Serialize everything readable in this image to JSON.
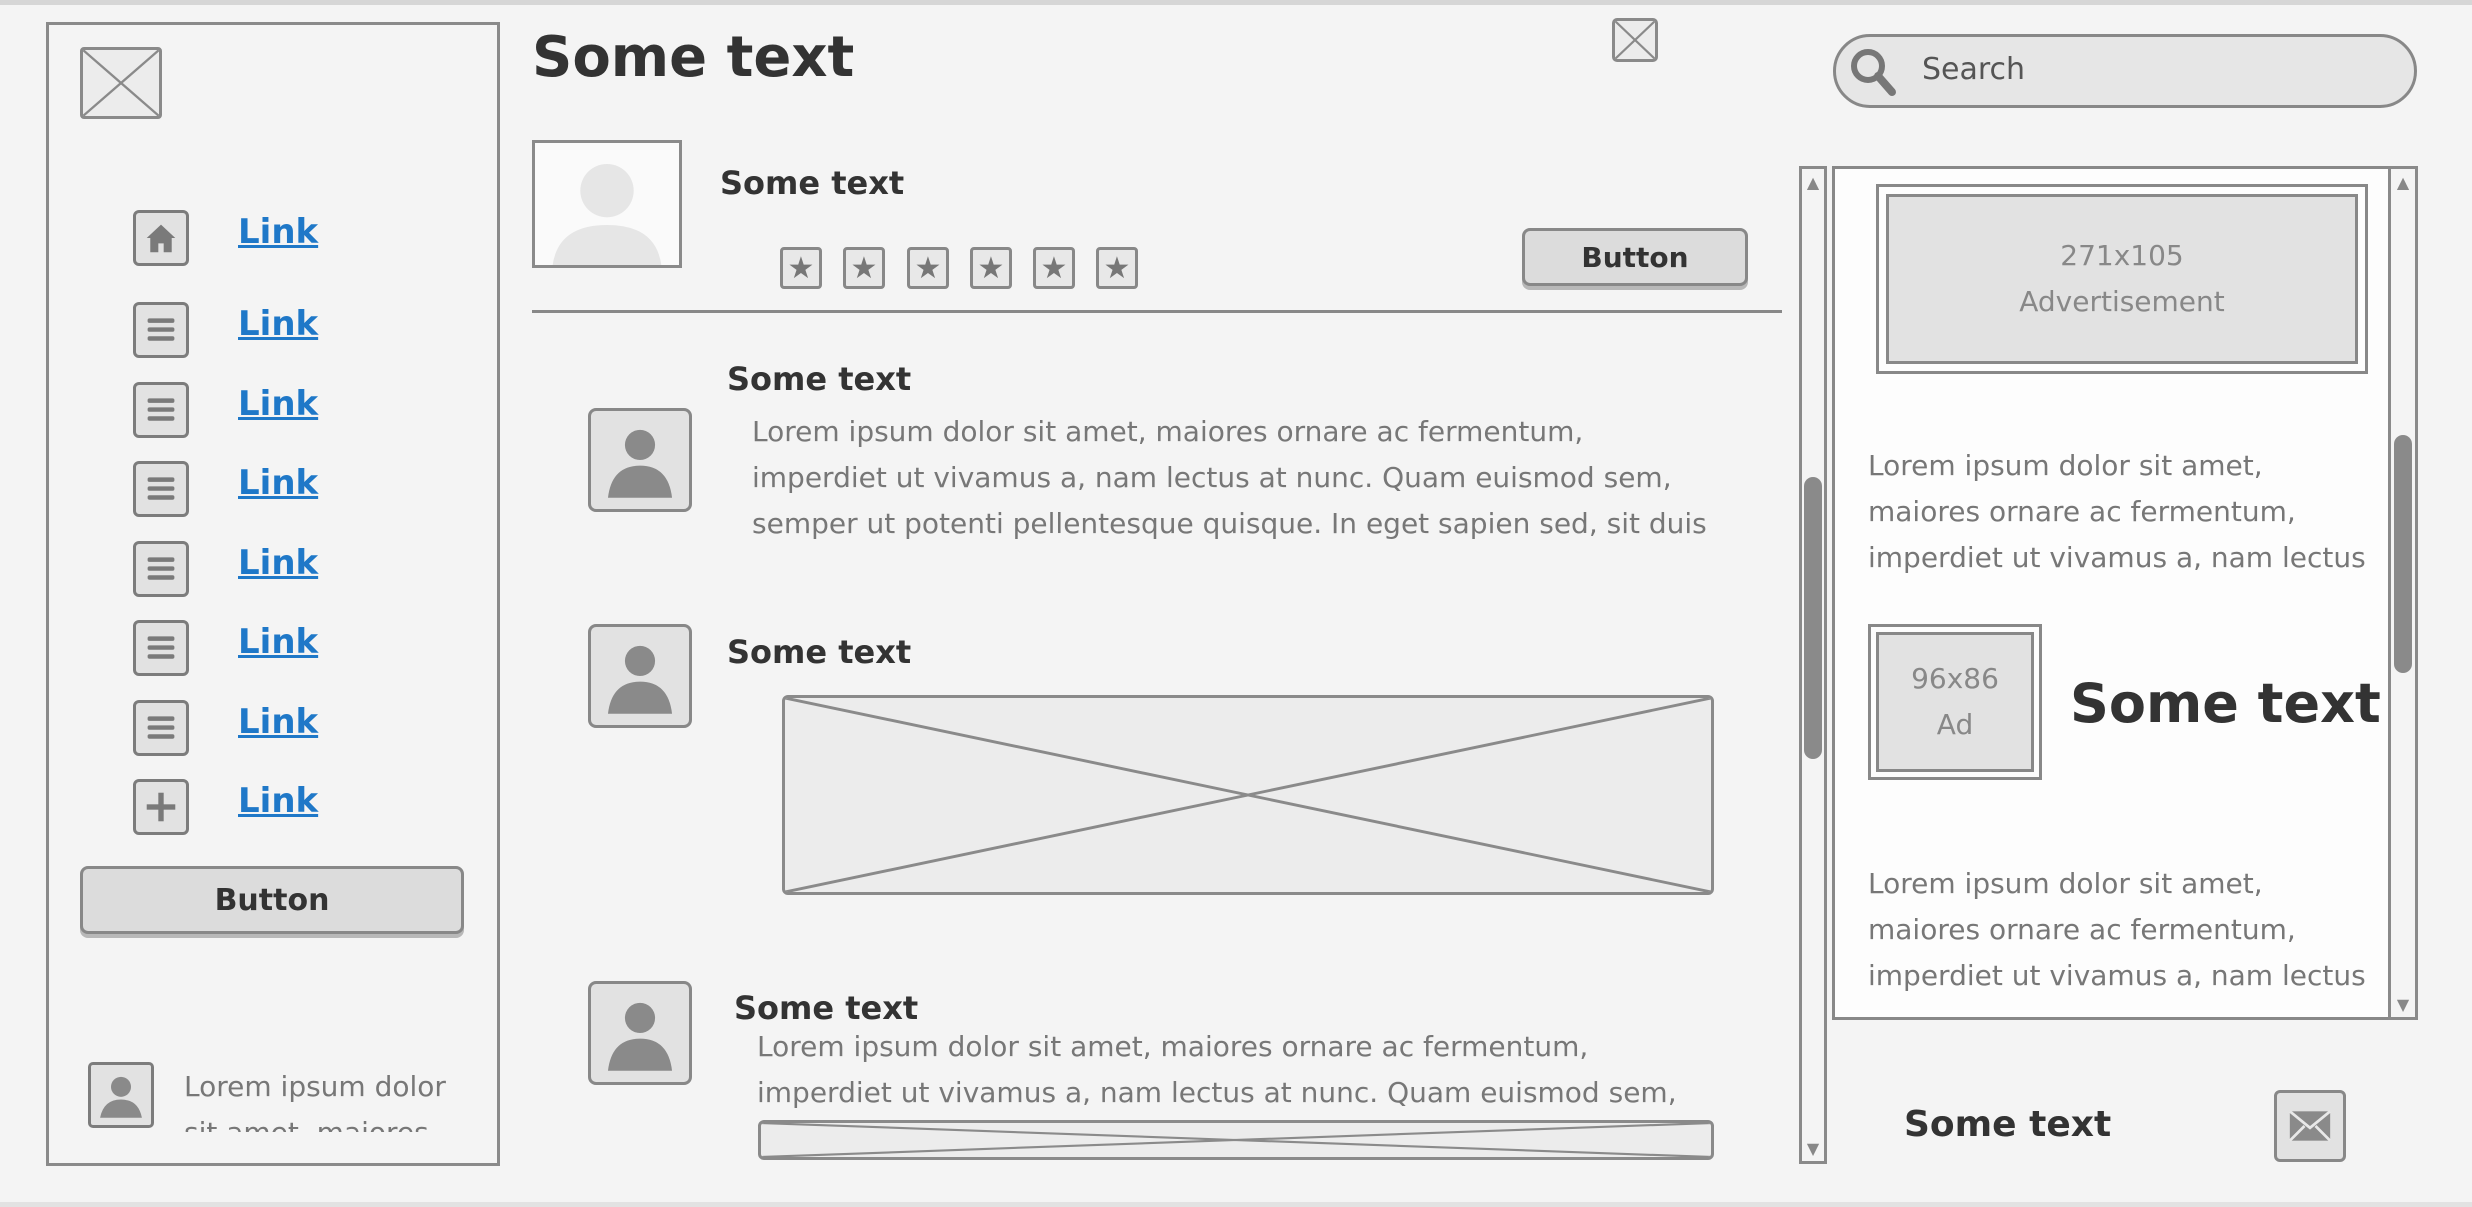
{
  "header": {
    "title": "Some text",
    "search_placeholder": "Search"
  },
  "sidebar": {
    "items": [
      {
        "label": "Link",
        "icon": "home-icon"
      },
      {
        "label": "Link",
        "icon": "list-icon"
      },
      {
        "label": "Link",
        "icon": "list-icon"
      },
      {
        "label": "Link",
        "icon": "list-icon"
      },
      {
        "label": "Link",
        "icon": "list-icon"
      },
      {
        "label": "Link",
        "icon": "list-icon"
      },
      {
        "label": "Link",
        "icon": "list-icon"
      },
      {
        "label": "Link",
        "icon": "plus-icon"
      }
    ],
    "button_label": "Button",
    "footer_text": "Lorem ipsum dolor sit amet, maiores ornare"
  },
  "profile": {
    "name": "Some text",
    "rating_stars": 6,
    "button_label": "Button"
  },
  "feed": [
    {
      "title": "Some text",
      "body": "Lorem ipsum dolor sit amet, maiores ornare ac fermentum, imperdiet ut vivamus a, nam lectus at nunc. Quam euismod sem, semper ut potenti pellentesque quisque. In eget sapien sed, sit duis vestibulum ultricies,"
    },
    {
      "title": "Some text"
    },
    {
      "title": "Some text",
      "body": "Lorem ipsum dolor sit amet, maiores ornare ac fermentum, imperdiet ut vivamus a, nam lectus at nunc. Quam euismod sem, semper ut potenti"
    }
  ],
  "right_panel": {
    "ad_top": {
      "size": "271x105",
      "label": "Advertisement"
    },
    "text1": "Lorem ipsum dolor sit amet, maiores ornare ac fermentum, imperdiet ut vivamus a, nam lectus at nunc. Quam",
    "ad_small": {
      "size": "96x86",
      "label": "Ad"
    },
    "heading": "Some text",
    "text2": "Lorem ipsum dolor sit amet, maiores ornare ac fermentum, imperdiet ut vivamus a, nam lectus at nunc. Quam"
  },
  "footer": {
    "text": "Some text",
    "icon": "mail-icon"
  },
  "colors": {
    "background": "#f4f4f4",
    "border": "#8a8a8a",
    "link": "#1f78c8",
    "fill": "#e2e2e2"
  }
}
